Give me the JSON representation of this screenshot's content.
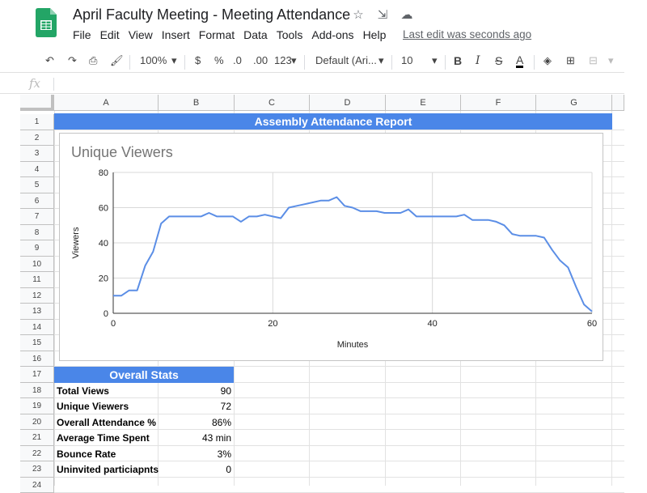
{
  "doc": {
    "title": "April Faculty Meeting - Meeting Attendance",
    "last_edit": "Last edit was seconds ago",
    "menu": [
      "File",
      "Edit",
      "View",
      "Insert",
      "Format",
      "Data",
      "Tools",
      "Add-ons",
      "Help"
    ]
  },
  "toolbar": {
    "zoom": "100%",
    "currency": "$",
    "percent": "%",
    "dec_decrease": ".0",
    "dec_increase": ".00",
    "more_formats": "123",
    "font": "Default (Ari...",
    "font_size": "10"
  },
  "formula_bar": {
    "fx": "fx"
  },
  "sheet": {
    "columns": [
      "A",
      "B",
      "C",
      "D",
      "E",
      "F",
      "G"
    ],
    "rows": [
      "1",
      "2",
      "3",
      "4",
      "5",
      "6",
      "7",
      "8",
      "9",
      "10",
      "11",
      "12",
      "13",
      "14",
      "15",
      "16",
      "17",
      "18",
      "19",
      "20",
      "21",
      "22",
      "23",
      "24"
    ],
    "banner": "Assembly Attendance Report",
    "stats_title": "Overall Stats",
    "stats": [
      {
        "label": "Total Views",
        "value": "90"
      },
      {
        "label": "Unique Viewers",
        "value": "72"
      },
      {
        "label": "Overall Attendance %",
        "value": "86%"
      },
      {
        "label": "Average Time Spent",
        "value": "43 min"
      },
      {
        "label": "Bounce Rate",
        "value": "3%"
      },
      {
        "label": "Uninvited particiapnts",
        "value": "0"
      }
    ]
  },
  "chart_data": {
    "type": "line",
    "title": "Unique Viewers",
    "xlabel": "Minutes",
    "ylabel": "Viewers",
    "xlim": [
      0,
      60
    ],
    "ylim": [
      0,
      80
    ],
    "xticks": [
      0,
      20,
      40,
      60
    ],
    "yticks": [
      0,
      20,
      40,
      60,
      80
    ],
    "color": "#5b8ee6",
    "x": [
      0,
      1,
      2,
      3,
      4,
      5,
      6,
      7,
      8,
      9,
      10,
      11,
      12,
      13,
      14,
      15,
      16,
      17,
      18,
      19,
      20,
      21,
      22,
      23,
      24,
      25,
      26,
      27,
      28,
      29,
      30,
      31,
      32,
      33,
      34,
      35,
      36,
      37,
      38,
      39,
      40,
      41,
      42,
      43,
      44,
      45,
      46,
      47,
      48,
      49,
      50,
      51,
      52,
      53,
      54,
      55,
      56,
      57,
      58,
      59,
      60
    ],
    "y": [
      10,
      10,
      13,
      13,
      27,
      35,
      51,
      55,
      55,
      55,
      55,
      55,
      57,
      55,
      55,
      55,
      52,
      55,
      55,
      56,
      55,
      54,
      60,
      61,
      62,
      63,
      64,
      64,
      66,
      61,
      60,
      58,
      58,
      58,
      57,
      57,
      57,
      59,
      55,
      55,
      55,
      55,
      55,
      55,
      56,
      53,
      53,
      53,
      52,
      50,
      45,
      44,
      44,
      44,
      43,
      36,
      30,
      26,
      15,
      5,
      1
    ]
  }
}
